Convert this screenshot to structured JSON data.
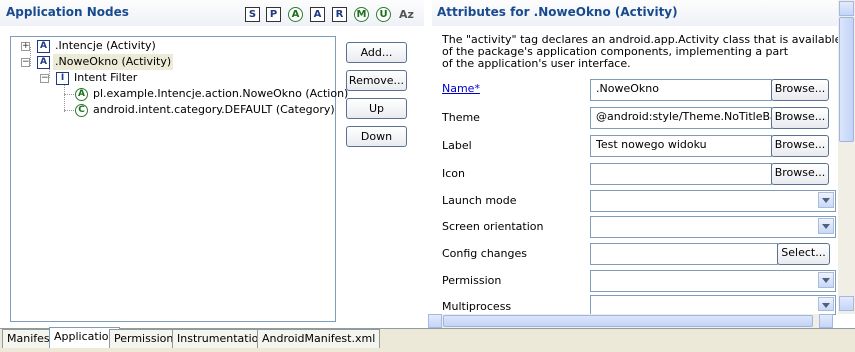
{
  "left": {
    "title": "Application Nodes",
    "toolbar_icons": [
      {
        "icon": "S",
        "shape": "square"
      },
      {
        "icon": "P",
        "shape": "square"
      },
      {
        "icon": "A",
        "shape": "circle"
      },
      {
        "icon": "A",
        "shape": "square"
      },
      {
        "icon": "R",
        "shape": "square"
      },
      {
        "icon": "M",
        "shape": "circle"
      },
      {
        "icon": "U",
        "shape": "circle"
      },
      {
        "icon": "Az",
        "shape": "plain"
      }
    ],
    "tree": [
      {
        "label": ".Intencje (Activity)",
        "icon": "A"
      },
      {
        "label": ".NoweOkno (Activity)",
        "icon": "A"
      },
      {
        "label": "Intent Filter",
        "icon": "I"
      },
      {
        "label": "pl.example.Intencje.action.NoweOkno (Action)",
        "icon": "A"
      },
      {
        "label": "android.intent.category.DEFAULT (Category)",
        "icon": "C"
      }
    ],
    "buttons": {
      "add": "Add...",
      "remove": "Remove...",
      "up": "Up",
      "down": "Down"
    }
  },
  "right": {
    "title": "Attributes for .NoweOkno (Activity)",
    "description": [
      "The \"activity\" tag declares an android.app.Activity class that is available as part",
      "of the package's application components, implementing a part",
      "of the application's user interface."
    ],
    "fields": {
      "name": {
        "label": "Name*",
        "value": ".NoweOkno",
        "button": "Browse..."
      },
      "theme": {
        "label": "Theme",
        "value": "@android:style/Theme.NoTitleBar",
        "button": "Browse..."
      },
      "label": {
        "label": "Label",
        "value": "Test nowego widoku",
        "button": "Browse..."
      },
      "icon": {
        "label": "Icon",
        "value": "",
        "button": "Browse..."
      },
      "launch_mode": {
        "label": "Launch mode",
        "value": ""
      },
      "screen_orientation": {
        "label": "Screen orientation",
        "value": ""
      },
      "config_changes": {
        "label": "Config changes",
        "value": "",
        "button": "Select..."
      },
      "permission": {
        "label": "Permission",
        "value": ""
      },
      "multiprocess": {
        "label": "Multiprocess",
        "value": ""
      }
    }
  },
  "tabs": [
    "Manifest",
    "Application",
    "Permissions",
    "Instrumentation",
    "AndroidManifest.xml"
  ],
  "active_tab": "Application",
  "colors": {
    "section_title": "#1a4a8e",
    "border": "#7f9db9",
    "selection": "#ecebd8"
  }
}
